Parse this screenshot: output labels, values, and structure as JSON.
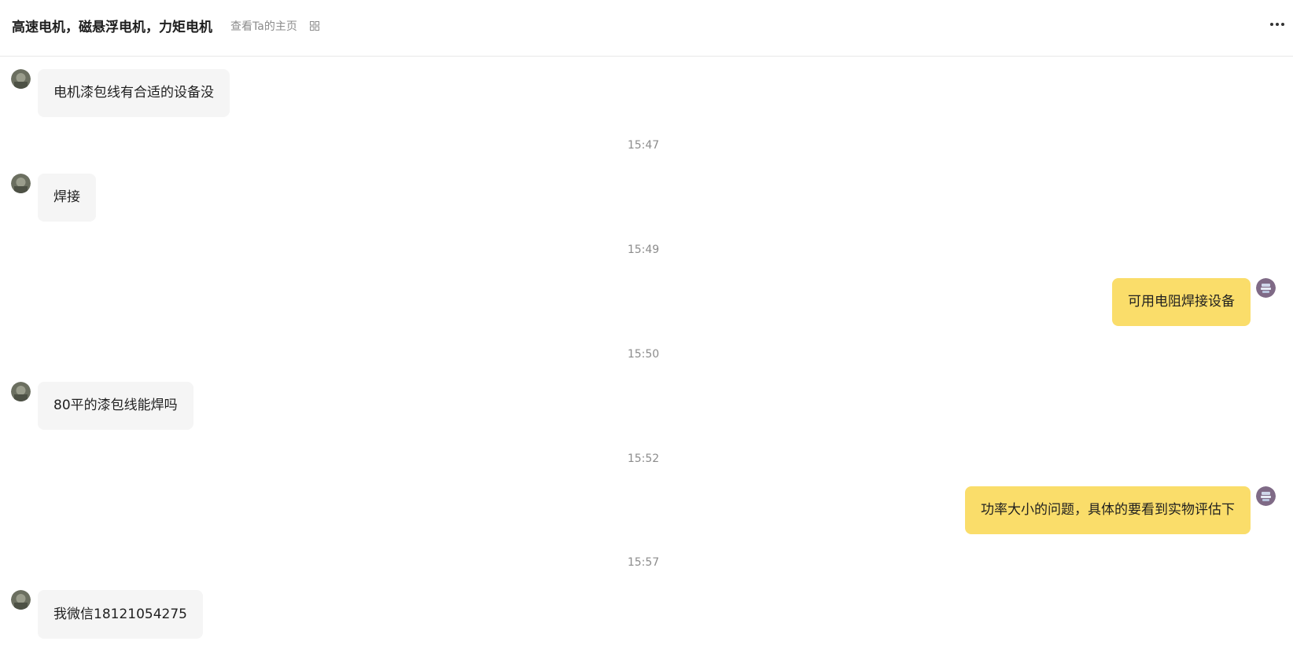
{
  "header": {
    "title": "高速电机，磁悬浮电机，力矩电机",
    "profile_link": "查看Ta的主页",
    "grid_icon": "grid-icon",
    "more_icon": "more-horizontal-icon"
  },
  "colors": {
    "incoming_bubble": "#f5f5f5",
    "outgoing_bubble": "#fadd6a",
    "timestamp": "#8c8c8c"
  },
  "messages": [
    {
      "direction": "in",
      "text": "电机漆包线有合适的设备没"
    },
    {
      "time": "15:47"
    },
    {
      "direction": "in",
      "text": "焊接"
    },
    {
      "time": "15:49"
    },
    {
      "direction": "out",
      "text": "可用电阻焊接设备"
    },
    {
      "time": "15:50"
    },
    {
      "direction": "in",
      "text": "80平的漆包线能焊吗"
    },
    {
      "time": "15:52"
    },
    {
      "direction": "out",
      "text": "功率大小的问题，具体的要看到实物评估下"
    },
    {
      "time": "15:57"
    },
    {
      "direction": "in",
      "text": "我微信18121054275"
    }
  ]
}
